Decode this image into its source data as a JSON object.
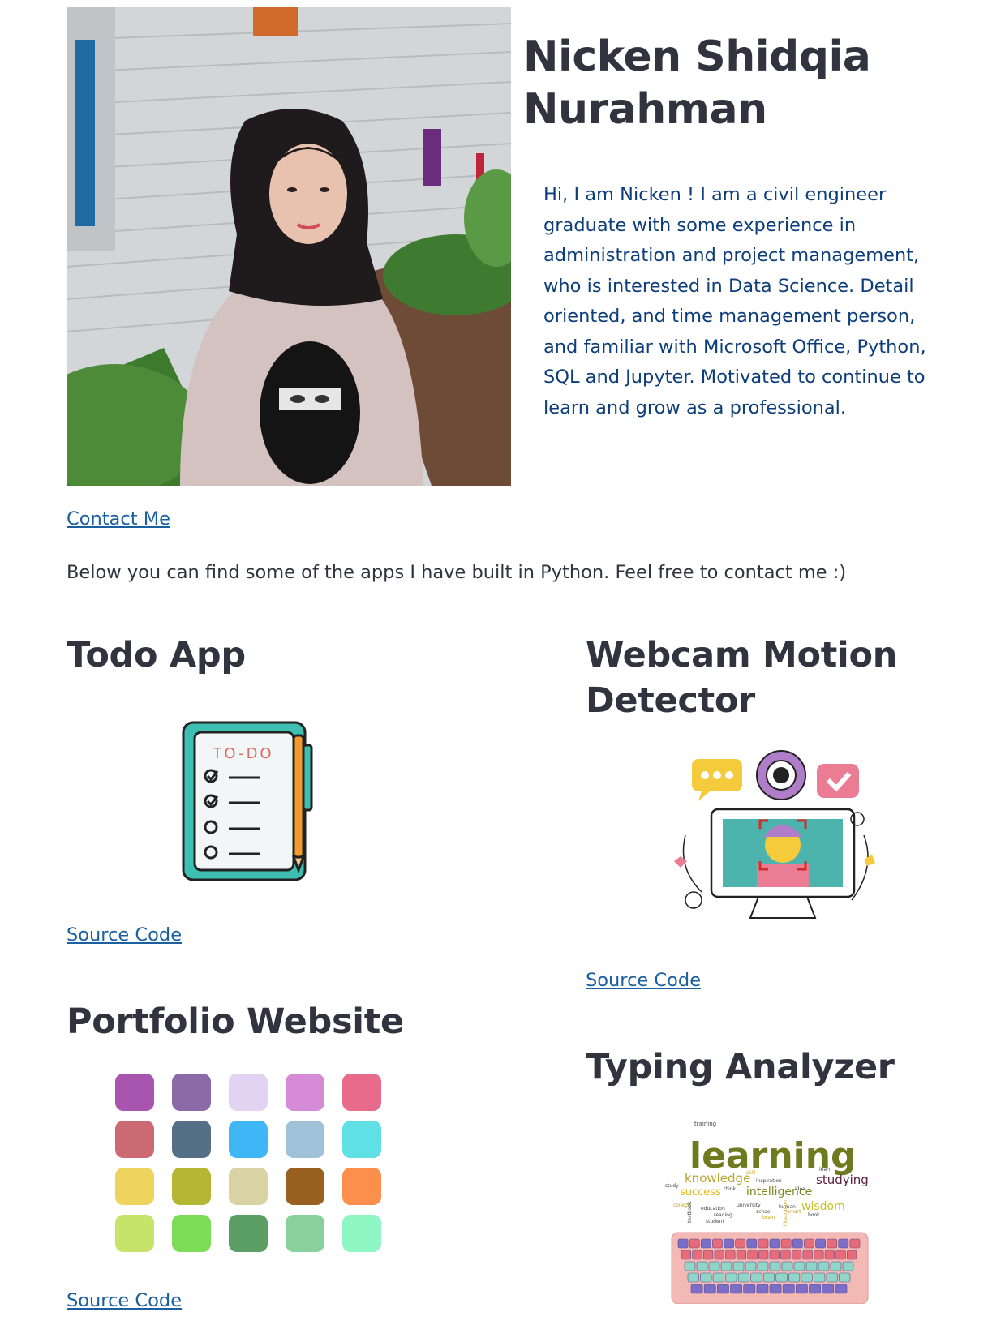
{
  "profile": {
    "name": "Nicken Shidqia Nurahman",
    "bio": "Hi, I am Nicken ! I am a civil engineer graduate with some experience in administration and project management, who is interested in Data Science. Detail oriented, and time management person, and familiar with Microsoft Office, Python, SQL and Jupyter. Motivated to continue to learn and grow as a professional."
  },
  "contact_link": "Contact Me",
  "intro": "Below you can find some of the apps I have built in Python. Feel free to contact me :)",
  "apps": [
    {
      "title": "Todo App",
      "link": "Source Code",
      "todo_label": "TO-DO",
      "icon": "todo-clipboard-icon"
    },
    {
      "title": "Webcam Motion Detector",
      "link": "Source Code",
      "icon": "webcam-monitor-icon"
    },
    {
      "title": "Portfolio Website",
      "link": "Source Code",
      "icon": "color-palette-icon"
    },
    {
      "title": "Typing Analyzer",
      "link": "Source Code",
      "icon": "word-cloud-keyboard-icon"
    }
  ],
  "palette_colors": [
    "#a855b0",
    "#8c6aa8",
    "#e2d3f2",
    "#d68bd8",
    "#e86b8c",
    "#cc6a73",
    "#556f86",
    "#3fb6f5",
    "#9fc2d8",
    "#5fe0e5",
    "#efd35f",
    "#b5b734",
    "#d9d3a3",
    "#99601f",
    "#fd8f4c",
    "#c7e46a",
    "#7ddc55",
    "#5b9f65",
    "#88d19d",
    "#8ff7c4"
  ],
  "wordcloud": {
    "main": "learning",
    "words": [
      "knowledge",
      "studying",
      "success",
      "intelligence",
      "wisdom",
      "training",
      "study",
      "think",
      "learn",
      "inspiration",
      "college",
      "education",
      "reading",
      "school",
      "book",
      "student",
      "university",
      "human",
      "smart",
      "brain",
      "skill",
      "textbook",
      "illustration",
      "idea"
    ]
  }
}
